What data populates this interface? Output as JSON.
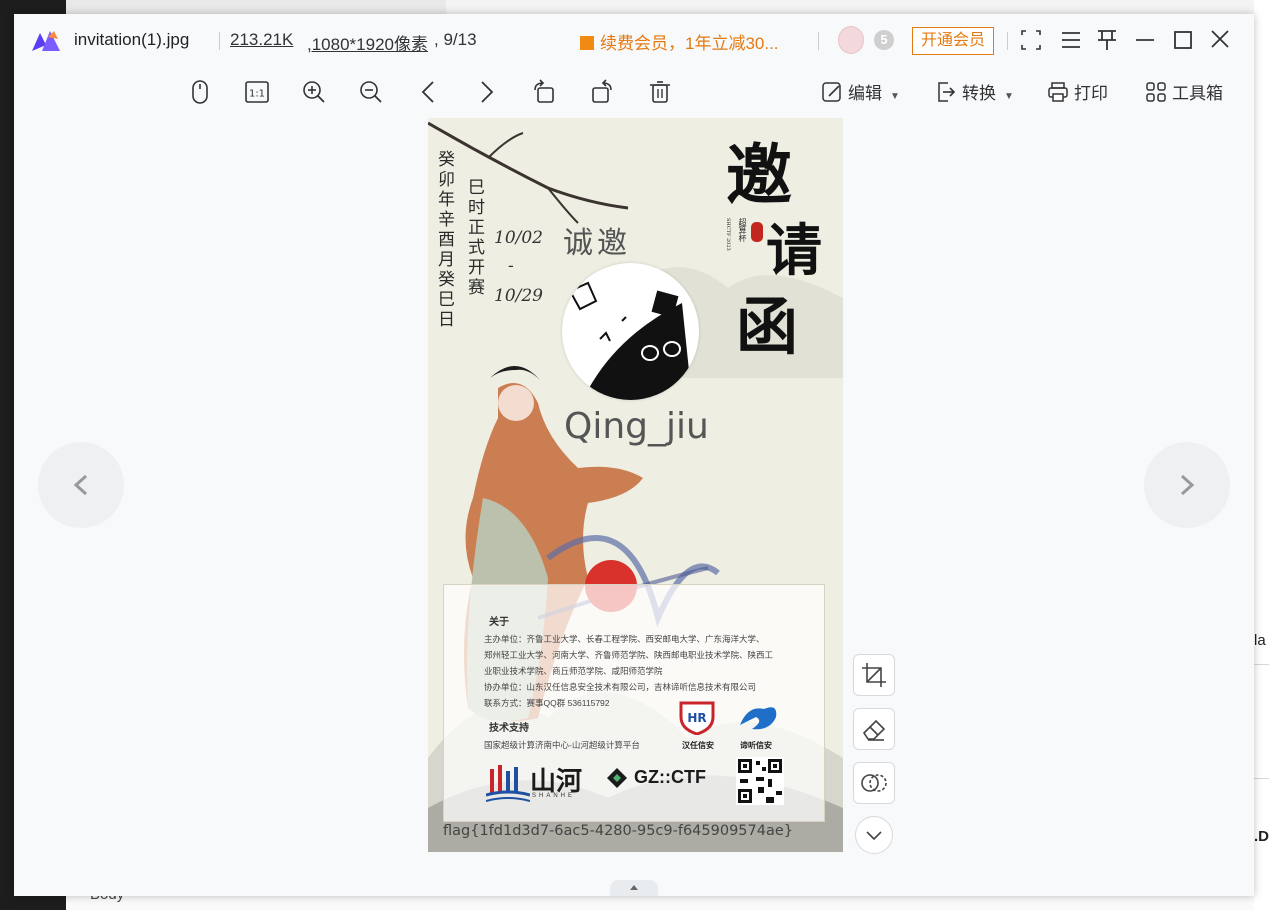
{
  "window": {
    "filename": "invitation(1).jpg",
    "file_size": "213.21K",
    "dimensions": ",1080*1920像素",
    "page_index": ", 9/13",
    "promo_text": "续费会员，1年立减30...",
    "vip_button": "开通会员",
    "accent_color": "#e57a12"
  },
  "toolbar": {
    "edit_label": "编辑",
    "convert_label": "转换",
    "print_label": "打印",
    "toolbox_label": "工具箱",
    "icons": [
      "mouse-icon",
      "actual-size-icon",
      "zoom-in-icon",
      "zoom-out-icon",
      "previous-icon",
      "next-icon",
      "rotate-left-icon",
      "rotate-right-icon",
      "delete-icon"
    ]
  },
  "image": {
    "calendar_line_1": "癸卯年辛酉月癸巳日",
    "calendar_line_2": "巳时正式开赛",
    "date_start": "10/02",
    "date_dash": "-",
    "date_end": "10/29",
    "small_title": "诚邀",
    "big_title_1": "邀",
    "big_title_2": "请",
    "big_title_3": "函",
    "seal_text": "超算杯",
    "seal_sub": "SHCTF 2023",
    "name": "Qing_jiu",
    "about_title": "关于",
    "about_lines": [
      "主办单位：齐鲁工业大学、长春工程学院、西安邮电大学、广东海洋大学、",
      "郑州轻工业大学、河南大学、齐鲁师范学院、陕西邮电职业技术学院、陕西工",
      "业职业技术学院、商丘师范学院、咸阳师范学院",
      "协办单位：山东汉任信息安全技术有限公司，吉林谛听信息技术有限公司",
      "联系方式：赛事QQ群 536115792"
    ],
    "tech_title": "技术支持",
    "tech_line": "国家超级计算济南中心-山河超级计算平台",
    "sponsor_1": "汉任信安",
    "sponsor_2": "谛听信安",
    "logo_shanhe": "山河",
    "logo_shanhe_sub": "SHANHE",
    "logo_hr": "HR",
    "logo_gz": "GZ::CTF",
    "flag": "flag{1fd1d3d7-6ac5-4280-95c9-f645909574ae}"
  },
  "background": {
    "body_label": "Body",
    "right_fragment_1": "la",
    "right_fragment_2": ".D"
  }
}
